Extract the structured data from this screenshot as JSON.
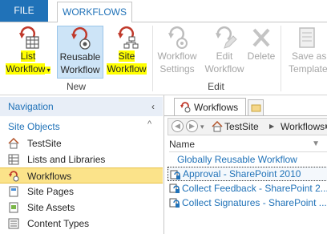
{
  "tabs": {
    "file": "FILE",
    "workflows": "WORKFLOWS"
  },
  "ribbon": {
    "new_group": "New",
    "edit_group": "Edit",
    "buttons": {
      "list_workflow": {
        "line1": "List",
        "line2": "Workflow"
      },
      "reusable_workflow": {
        "line1": "Reusable",
        "line2": "Workflow"
      },
      "site_workflow": {
        "line1": "Site",
        "line2": "Workflow"
      },
      "workflow_settings": {
        "line1": "Workflow",
        "line2": "Settings"
      },
      "edit_workflow": {
        "line1": "Edit",
        "line2": "Workflow"
      },
      "delete": {
        "line1": "Delete",
        "line2": ""
      },
      "save_as_template": {
        "line1": "Save as",
        "line2": "Template"
      }
    }
  },
  "nav": {
    "header": "Navigation",
    "collapse_chevron": "‹",
    "section": "Site Objects",
    "section_chevron": "^",
    "items": [
      {
        "label": "TestSite",
        "icon": "home-icon"
      },
      {
        "label": "Lists and Libraries",
        "icon": "list-icon"
      },
      {
        "label": "Workflows",
        "icon": "workflow-icon"
      },
      {
        "label": "Site Pages",
        "icon": "pages-icon"
      },
      {
        "label": "Site Assets",
        "icon": "assets-icon"
      },
      {
        "label": "Content Types",
        "icon": "content-types-icon"
      }
    ]
  },
  "main": {
    "tab_label": "Workflows",
    "breadcrumb": {
      "site": "TestSite",
      "sep": "▶",
      "current": "Workflows",
      "sep2": "▶"
    },
    "column_name": "Name",
    "group_label": "Globally Reusable Workflow",
    "rows": [
      {
        "label": "Approval - SharePoint 2010"
      },
      {
        "label": "Collect Feedback - SharePoint 2..."
      },
      {
        "label": "Collect Signatures - SharePoint ..."
      }
    ]
  },
  "colors": {
    "accent": "#2072b8",
    "highlight": "#ffff00",
    "selected": "#fbe38a"
  }
}
